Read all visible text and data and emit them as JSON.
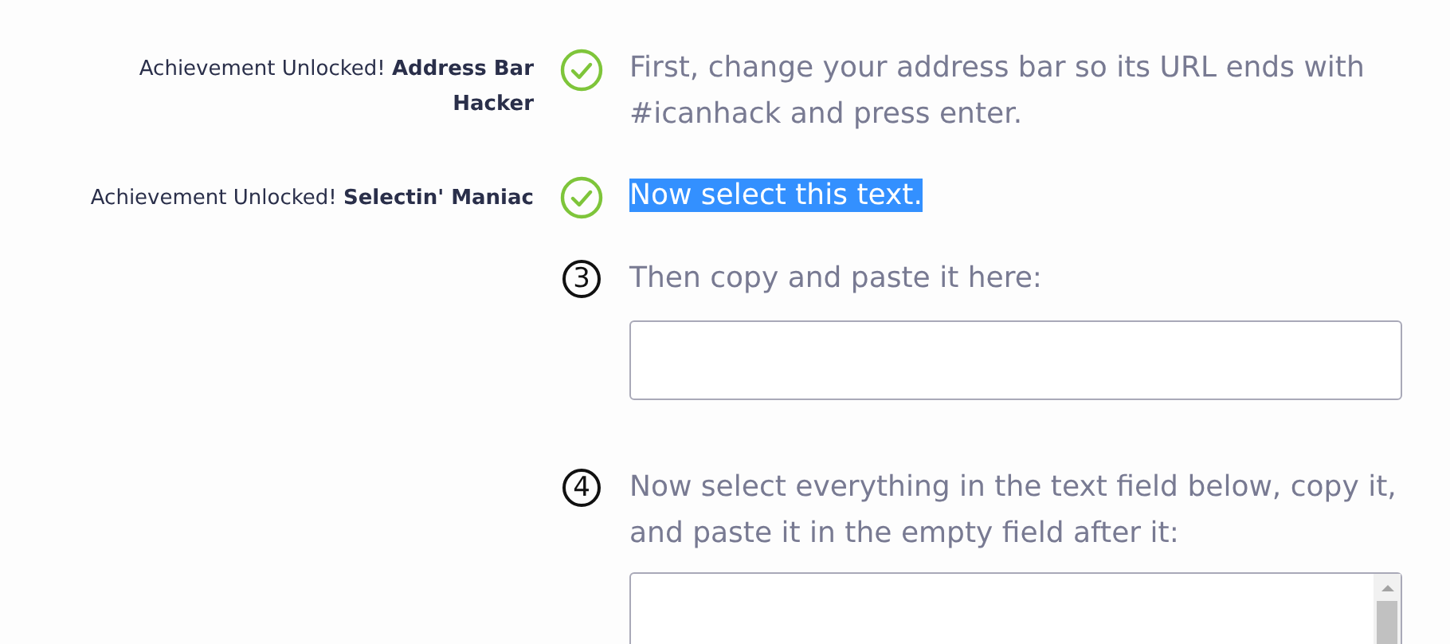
{
  "steps": [
    {
      "kind": "done",
      "achievement": "Achievement Unlocked! **Address Bar Hacker**",
      "instruction": "First, change your address bar so its URL ends with #icanhack and press enter.",
      "highlighted": false
    },
    {
      "kind": "done",
      "achievement": "Achievement Unlocked! **Selectin' Maniac**",
      "instruction": "Now select this text.",
      "highlighted": true
    },
    {
      "kind": "numbered",
      "number": "3",
      "instruction": "Then copy and paste it here:",
      "highlighted": false,
      "field": {
        "kind": "input"
      }
    },
    {
      "kind": "numbered",
      "number": "4",
      "instruction": "Now select everything in the text field below, copy it, and paste it in the empty field after it:",
      "highlighted": false,
      "field": {
        "kind": "textarea"
      }
    }
  ]
}
